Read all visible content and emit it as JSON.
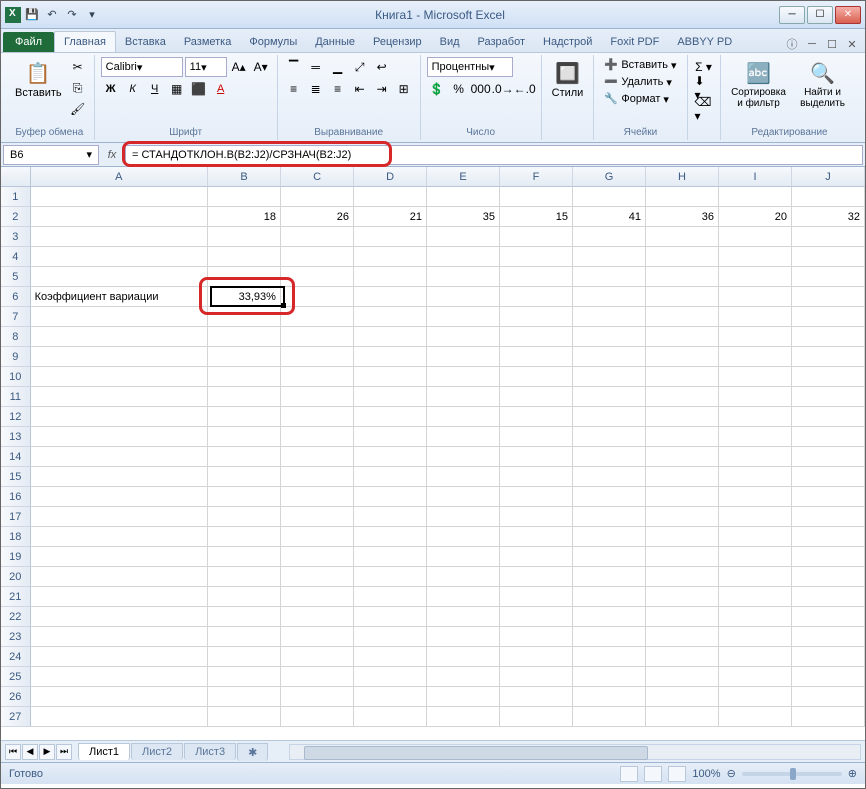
{
  "title": "Книга1 - Microsoft Excel",
  "qat": {
    "save": "💾",
    "undo": "↶",
    "redo": "↷"
  },
  "tabs": {
    "file": "Файл",
    "home": "Главная",
    "insert": "Вставка",
    "layout": "Разметка",
    "formulas": "Формулы",
    "data": "Данные",
    "review": "Рецензир",
    "view": "Вид",
    "dev": "Разработ",
    "addins": "Надстрой",
    "foxit": "Foxit PDF",
    "abbyy": "ABBYY PD"
  },
  "ribbon": {
    "clipboard": {
      "paste": "Вставить",
      "label": "Буфер обмена"
    },
    "font": {
      "name": "Calibri",
      "size": "11",
      "label": "Шрифт"
    },
    "align": {
      "label": "Выравнивание"
    },
    "number": {
      "format": "Процентны",
      "label": "Число"
    },
    "styles": {
      "btn": "Стили"
    },
    "cells": {
      "insert": "Вставить",
      "delete": "Удалить",
      "format": "Формат",
      "label": "Ячейки"
    },
    "editing": {
      "sort": "Сортировка и фильтр",
      "find": "Найти и выделить",
      "label": "Редактирование"
    }
  },
  "namebox": "B6",
  "formula": "= СТАНДОТКЛОН.В(B2:J2)/СРЗНАЧ(B2:J2)",
  "cols": [
    "A",
    "B",
    "C",
    "D",
    "E",
    "F",
    "G",
    "H",
    "I",
    "J"
  ],
  "row2": {
    "b": "18",
    "c": "26",
    "d": "21",
    "e": "35",
    "f": "15",
    "g": "41",
    "h": "36",
    "i": "20",
    "j": "32"
  },
  "row6": {
    "a": "Коэффициент вариации",
    "b": "33,93%"
  },
  "sheets": {
    "s1": "Лист1",
    "s2": "Лист2",
    "s3": "Лист3"
  },
  "status": {
    "ready": "Готово",
    "zoom": "100%"
  }
}
